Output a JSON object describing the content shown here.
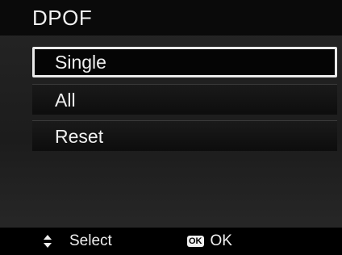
{
  "header": {
    "title": "DPOF"
  },
  "menu": {
    "items": [
      {
        "label": "Single",
        "selected": true
      },
      {
        "label": "All",
        "selected": false
      },
      {
        "label": "Reset",
        "selected": false
      }
    ]
  },
  "footer": {
    "select_icon": "up-down-arrows-icon",
    "select_label": "Select",
    "ok_icon_text": "OK",
    "ok_label": "OK"
  },
  "colors": {
    "background": "#1c1c1c",
    "highlight_border": "#eaeaea",
    "text": "#f0f0f0"
  }
}
